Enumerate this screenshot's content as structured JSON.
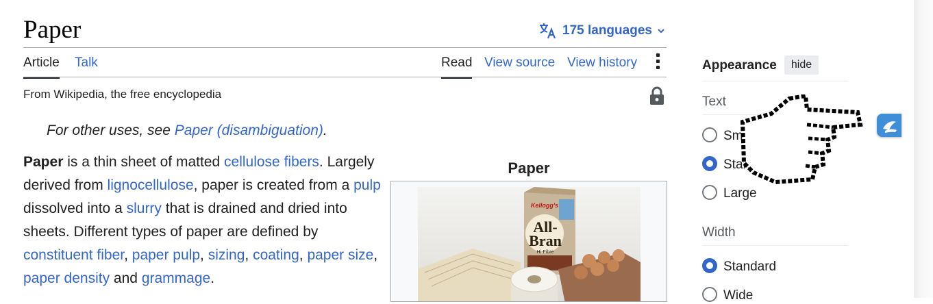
{
  "page": {
    "title": "Paper",
    "languages_label": "175 languages"
  },
  "tabs": {
    "article": "Article",
    "talk": "Talk",
    "read": "Read",
    "view_source": "View source",
    "view_history": "View history"
  },
  "tagline": "From Wikipedia, the free encyclopedia",
  "hatnote": {
    "prefix": "For other uses, see ",
    "link": "Paper (disambiguation)",
    "suffix": "."
  },
  "paragraph": {
    "bold": "Paper",
    "t1": " is a thin sheet of matted ",
    "l1": "cellulose fibers",
    "t2": ". Largely derived from ",
    "l2": "lignocellulose",
    "t3": ", paper is created from a ",
    "l3": "pulp",
    "t4": " dissolved into a ",
    "l4": "slurry",
    "t5": " that is drained and dried into sheets. Different types of paper are defined by ",
    "l5": "constituent fiber",
    "t6": ", ",
    "l6": "paper pulp",
    "t7": ", ",
    "l7": "sizing",
    "t8": ", ",
    "l8": "coating",
    "t9": ", ",
    "l9": "paper size",
    "t10": ", ",
    "l10": "paper density",
    "t11": " and ",
    "l11": "grammage",
    "t12": "."
  },
  "infobox": {
    "caption": "Paper",
    "box_brand": "Kellogg's",
    "box_name1": "All-",
    "box_name2": "Bran",
    "box_sub": "Hi-Fibre"
  },
  "appearance": {
    "title": "Appearance",
    "hide_label": "hide",
    "text_section": "Text",
    "text_options": [
      "Small",
      "Standard",
      "Large"
    ],
    "text_selected": "Standard",
    "width_section": "Width",
    "width_options": [
      "Standard",
      "Wide"
    ],
    "width_selected": "Standard"
  },
  "icons": {
    "language": "translate-icon",
    "chevron": "chevron-down-icon",
    "lock": "lock-icon",
    "more": "more-vertical-icon",
    "extension": "extension-icon",
    "cursor": "hand-pointer-cursor"
  },
  "colors": {
    "link": "#3366cc",
    "text": "#202122",
    "border": "#a2a9b1",
    "radio_on": "#3366cc"
  }
}
